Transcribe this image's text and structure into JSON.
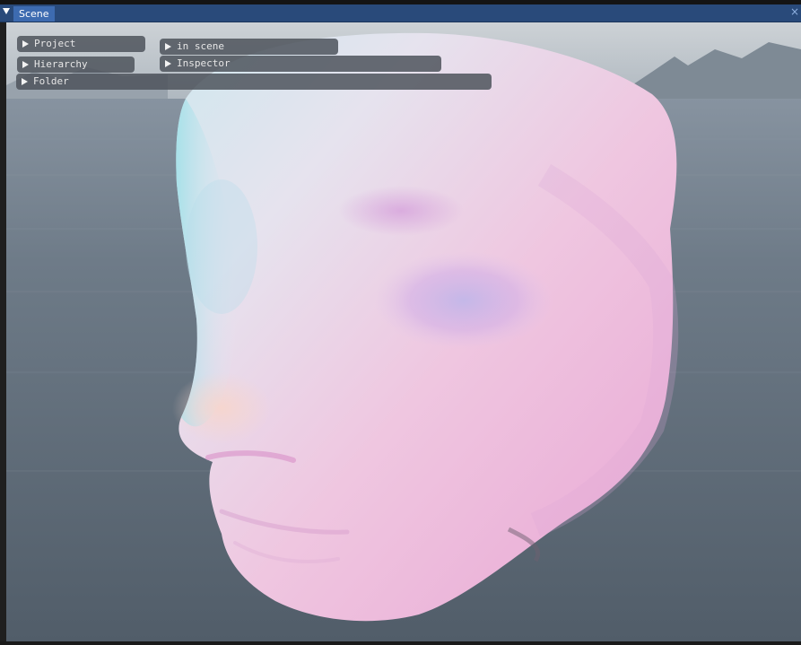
{
  "window": {
    "tab_label": "Scene",
    "close_glyph": "×",
    "collapse_icon": "triangle-down-icon"
  },
  "viewport": {
    "description_icon": "face-mesh",
    "colors": {
      "titlebar": "#294a7a",
      "tab": "#3d6bb0",
      "panel_bg": "#4e545c"
    }
  },
  "panels": [
    {
      "label": "Project"
    },
    {
      "label": "in scene"
    },
    {
      "label": "Hierarchy"
    },
    {
      "label": "Inspector"
    },
    {
      "label": "Folder"
    }
  ]
}
